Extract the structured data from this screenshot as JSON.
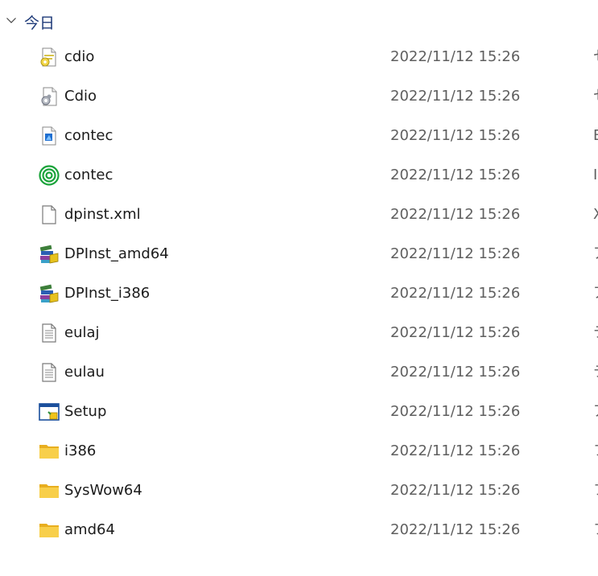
{
  "group": {
    "label": "今日",
    "chevron_icon": "chevron-down-icon"
  },
  "files": [
    {
      "name": "cdio",
      "date": "2022/11/12 15:26",
      "type": "セ",
      "icon": "config-settings-icon"
    },
    {
      "name": "Cdio",
      "date": "2022/11/12 15:26",
      "type": "セ",
      "icon": "gear-file-icon"
    },
    {
      "name": "contec",
      "date": "2022/11/12 15:26",
      "type": "B",
      "icon": "blue-document-icon"
    },
    {
      "name": "contec",
      "date": "2022/11/12 15:26",
      "type": "I",
      "icon": "green-target-icon"
    },
    {
      "name": "dpinst.xml",
      "date": "2022/11/12 15:26",
      "type": "X",
      "icon": "blank-file-icon"
    },
    {
      "name": "DPInst_amd64",
      "date": "2022/11/12 15:26",
      "type": "ア",
      "icon": "installer-books-icon"
    },
    {
      "name": "DPInst_i386",
      "date": "2022/11/12 15:26",
      "type": "ア",
      "icon": "installer-books-icon"
    },
    {
      "name": "eulaj",
      "date": "2022/11/12 15:26",
      "type": "テ",
      "icon": "text-file-icon"
    },
    {
      "name": "eulau",
      "date": "2022/11/12 15:26",
      "type": "テ",
      "icon": "text-file-icon"
    },
    {
      "name": "Setup",
      "date": "2022/11/12 15:26",
      "type": "ア",
      "icon": "setup-window-icon"
    },
    {
      "name": "i386",
      "date": "2022/11/12 15:26",
      "type": "フ",
      "icon": "folder-icon"
    },
    {
      "name": "SysWow64",
      "date": "2022/11/12 15:26",
      "type": "フ",
      "icon": "folder-icon"
    },
    {
      "name": "amd64",
      "date": "2022/11/12 15:26",
      "type": "フ",
      "icon": "folder-icon"
    }
  ],
  "colors": {
    "group_label": "#1e3a78",
    "date_text": "#5f5f5f",
    "folder_yellow": "#f5c53d"
  }
}
